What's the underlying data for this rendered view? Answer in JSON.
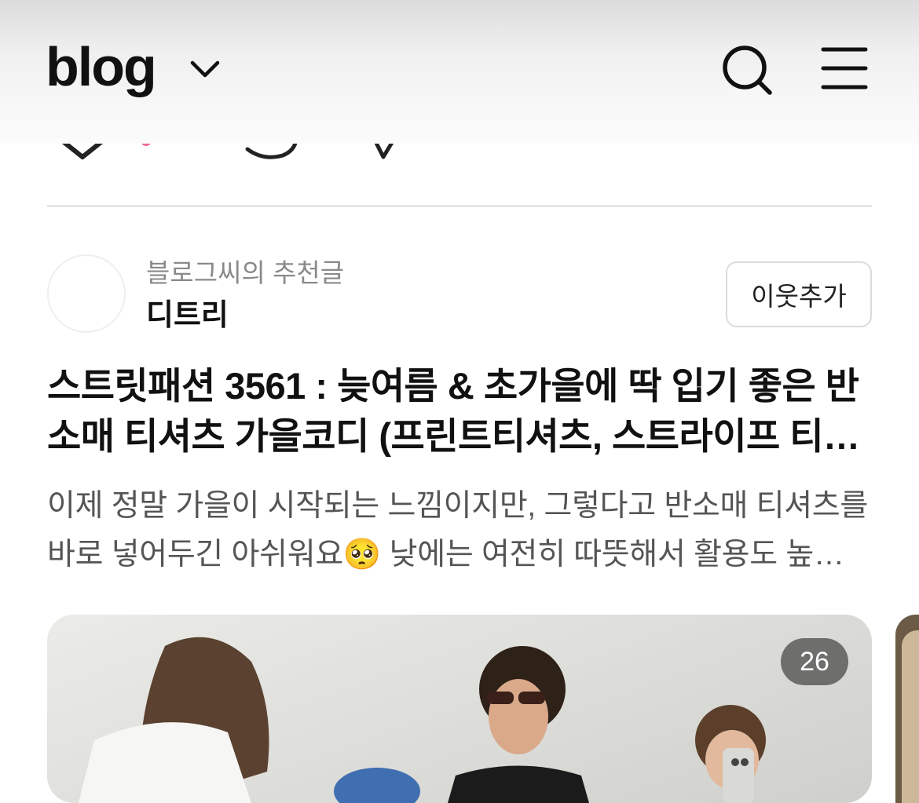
{
  "header": {
    "logo": "blog",
    "icons": [
      "chevron-down-icon",
      "search-icon",
      "menu-icon"
    ]
  },
  "post": {
    "recommend_label": "블로그씨의 추천글",
    "author": "디트리",
    "follow_label": "이웃추가",
    "title": "스트릿패션 3561 : 늦여름 & 초가을에 딱 입기 좋은 반소매 티셔츠 가을코디 (프린트티셔츠, 스트라이프 티셔츠)",
    "excerpt": "이제 정말 가을이 시작되는 느낌이지만, 그렇다고 반소매 티셔츠를 바로 넣어두긴 아쉬워요🥺  낮에는 여전히 따뜻해서 활용도 높은 반소매 티셔츠 코디를 소개할게요",
    "image_count": "26"
  },
  "colors": {
    "accent_pink": "#f06292",
    "text": "#111111",
    "muted": "#8a8a8a"
  }
}
